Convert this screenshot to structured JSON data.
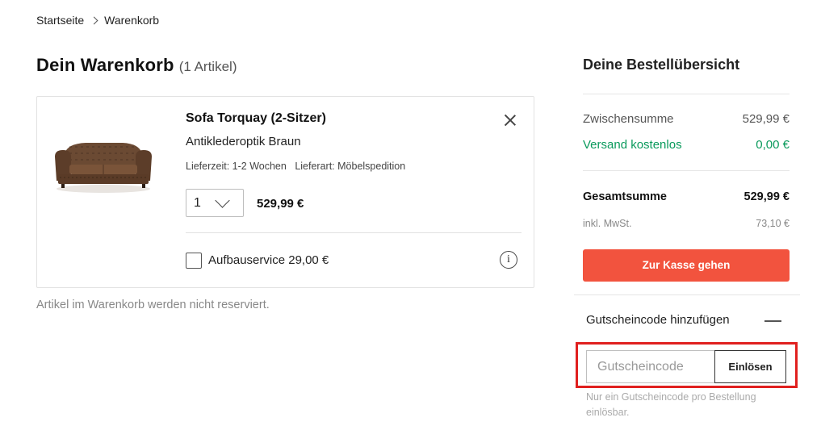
{
  "breadcrumb": {
    "items": [
      "Startseite",
      "Warenkorb"
    ]
  },
  "cart": {
    "title": "Dein Warenkorb",
    "count_label": "(1 Artikel)",
    "note": "Artikel im Warenkorb werden nicht reserviert."
  },
  "product": {
    "title": "Sofa Torquay (2-Sitzer)",
    "variant": "Antiklederoptik Braun",
    "delivery_time": "Lieferzeit: 1-2 Wochen",
    "delivery_type": "Lieferart: Möbelspedition",
    "quantity": "1",
    "price": "529,99 €",
    "image_icon": "sofa-image",
    "service_label": "Aufbauservice 29,00 €",
    "service_checked": false
  },
  "summary": {
    "title": "Deine Bestellübersicht",
    "subtotal_label": "Zwischensumme",
    "subtotal_value": "529,99 €",
    "shipping_label": "Versand kostenlos",
    "shipping_value": "0,00 €",
    "total_label": "Gesamtsumme",
    "total_value": "529,99 €",
    "tax_label": "inkl. MwSt.",
    "tax_value": "73,10 €",
    "checkout_label": "Zur Kasse gehen"
  },
  "coupon": {
    "header": "Gutscheincode hinzufügen",
    "placeholder": "Gutscheincode",
    "redeem_label": "Einlösen",
    "note": "Nur ein Gutscheincode pro Bestellung einlösbar."
  },
  "colors": {
    "accent": "#f2533e",
    "success": "#0a9a5c",
    "highlight": "#e0201f"
  }
}
